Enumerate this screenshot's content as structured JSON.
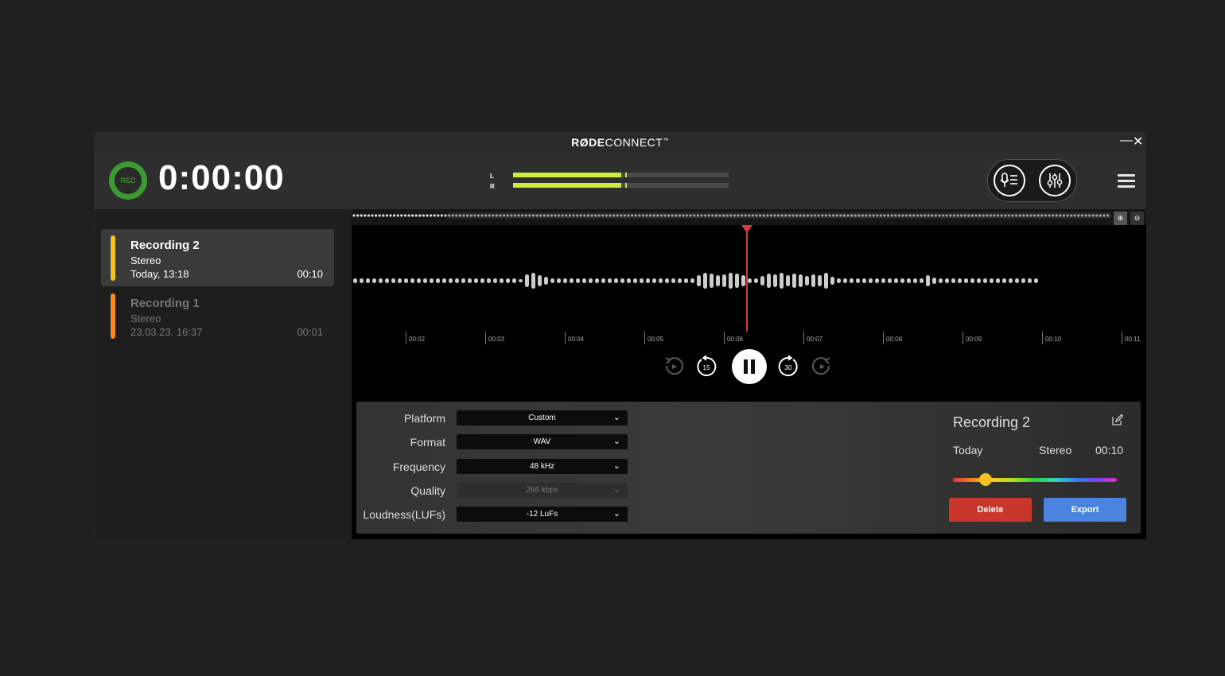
{
  "titlebar": {
    "brand_bold": "RØDE",
    "brand_rest": "CONNECT",
    "brand_tm": "™",
    "minimize": "—",
    "close": "✕"
  },
  "header": {
    "rec_label": "REC",
    "timer": "0:00:00",
    "meter": {
      "left_label": "L",
      "right_label": "R",
      "left_level": 0.5,
      "right_level": 0.5,
      "peak_level": 0.52
    },
    "modes": [
      "mic-list-icon",
      "mixer-sliders-icon"
    ],
    "menu_icon": "hamburger-menu-icon"
  },
  "recordings": [
    {
      "name": "Recording 2",
      "type": "Stereo",
      "date": "Today, 13:18",
      "duration": "00:10",
      "color": "#f5c223",
      "active": true
    },
    {
      "name": "Recording 1",
      "type": "Stereo",
      "date": "23.03.23, 16:37",
      "duration": "00:01",
      "color": "#f58a1f",
      "active": false
    }
  ],
  "timeline": {
    "ticks": [
      "00:02",
      "00:03",
      "00:04",
      "00:05",
      "00:06",
      "00:07",
      "00:08",
      "00:09",
      "00:10",
      "00:11"
    ],
    "playhead_color": "#d6393f",
    "zoom_in_icon": "zoom-in-icon",
    "zoom_out_icon": "zoom-out-icon"
  },
  "transport": {
    "skip_back_15": "15",
    "skip_fwd_30": "30",
    "state": "playing"
  },
  "export": {
    "fields": [
      {
        "label": "Platform",
        "value": "Custom",
        "disabled": false
      },
      {
        "label": "Format",
        "value": "WAV",
        "disabled": false
      },
      {
        "label": "Frequency",
        "value": "48 kHz",
        "disabled": false
      },
      {
        "label": "Quality",
        "value": "256 kbps",
        "disabled": true
      },
      {
        "label": "Loudness(LUFs)",
        "value": "-12 LuFs",
        "disabled": false
      }
    ],
    "summary": {
      "title": "Recording 2",
      "date": "Today",
      "type": "Stereo",
      "duration": "00:10",
      "color_position": 0.2
    },
    "delete_label": "Delete",
    "export_label": "Export",
    "delete_color": "#c9362b",
    "export_color": "#4a84e0"
  }
}
